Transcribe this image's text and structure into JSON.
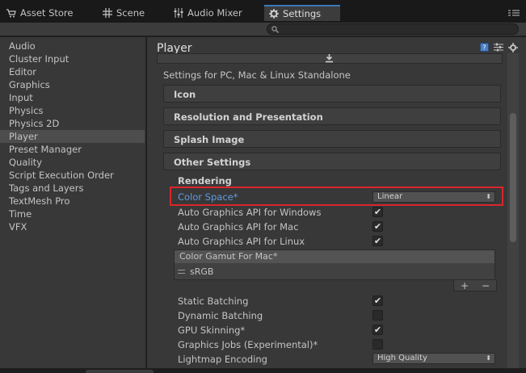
{
  "tabs": [
    {
      "label": "Asset Store",
      "icon": "cart-icon"
    },
    {
      "label": "Scene",
      "icon": "grid-icon"
    },
    {
      "label": "Audio Mixer",
      "icon": "mixer-icon"
    },
    {
      "label": "Settings",
      "icon": "gear-icon",
      "active": true
    }
  ],
  "search": {
    "placeholder": "",
    "value": ""
  },
  "sidebar": {
    "items": [
      {
        "label": "Audio"
      },
      {
        "label": "Cluster Input"
      },
      {
        "label": "Editor"
      },
      {
        "label": "Graphics"
      },
      {
        "label": "Input"
      },
      {
        "label": "Physics"
      },
      {
        "label": "Physics 2D"
      },
      {
        "label": "Player",
        "selected": true
      },
      {
        "label": "Preset Manager"
      },
      {
        "label": "Quality"
      },
      {
        "label": "Script Execution Order"
      },
      {
        "label": "Tags and Layers"
      },
      {
        "label": "TextMesh Pro"
      },
      {
        "label": "Time"
      },
      {
        "label": "VFX"
      }
    ]
  },
  "main": {
    "title": "Player",
    "platform_label": "Settings for PC, Mac & Linux Standalone",
    "sections": [
      {
        "label": "Icon"
      },
      {
        "label": "Resolution and Presentation"
      },
      {
        "label": "Splash Image"
      },
      {
        "label": "Other Settings"
      }
    ],
    "rendering": {
      "heading": "Rendering",
      "color_space": {
        "label": "Color Space*",
        "value": "Linear"
      },
      "auto_api_windows": {
        "label": "Auto Graphics API  for Windows",
        "checked": true
      },
      "auto_api_mac": {
        "label": "Auto Graphics API  for Mac",
        "checked": true
      },
      "auto_api_linux": {
        "label": "Auto Graphics API  for Linux",
        "checked": true
      },
      "color_gamut": {
        "header": "Color Gamut For Mac*",
        "items": [
          "sRGB"
        ]
      },
      "static_batching": {
        "label": "Static Batching",
        "checked": true
      },
      "dynamic_batching": {
        "label": "Dynamic Batching",
        "checked": false
      },
      "gpu_skinning": {
        "label": "GPU Skinning*",
        "checked": true
      },
      "graphics_jobs": {
        "label": "Graphics Jobs (Experimental)*",
        "checked": false
      },
      "lightmap_encoding": {
        "label": "Lightmap Encoding",
        "value": "High Quality"
      }
    },
    "list_buttons": {
      "add": "+",
      "remove": "−"
    },
    "check_mark": "✔"
  },
  "colors": {
    "highlight_text": "#5d9be0",
    "red_outline": "#d9262c",
    "active_tab_border": "#3a79bb"
  }
}
